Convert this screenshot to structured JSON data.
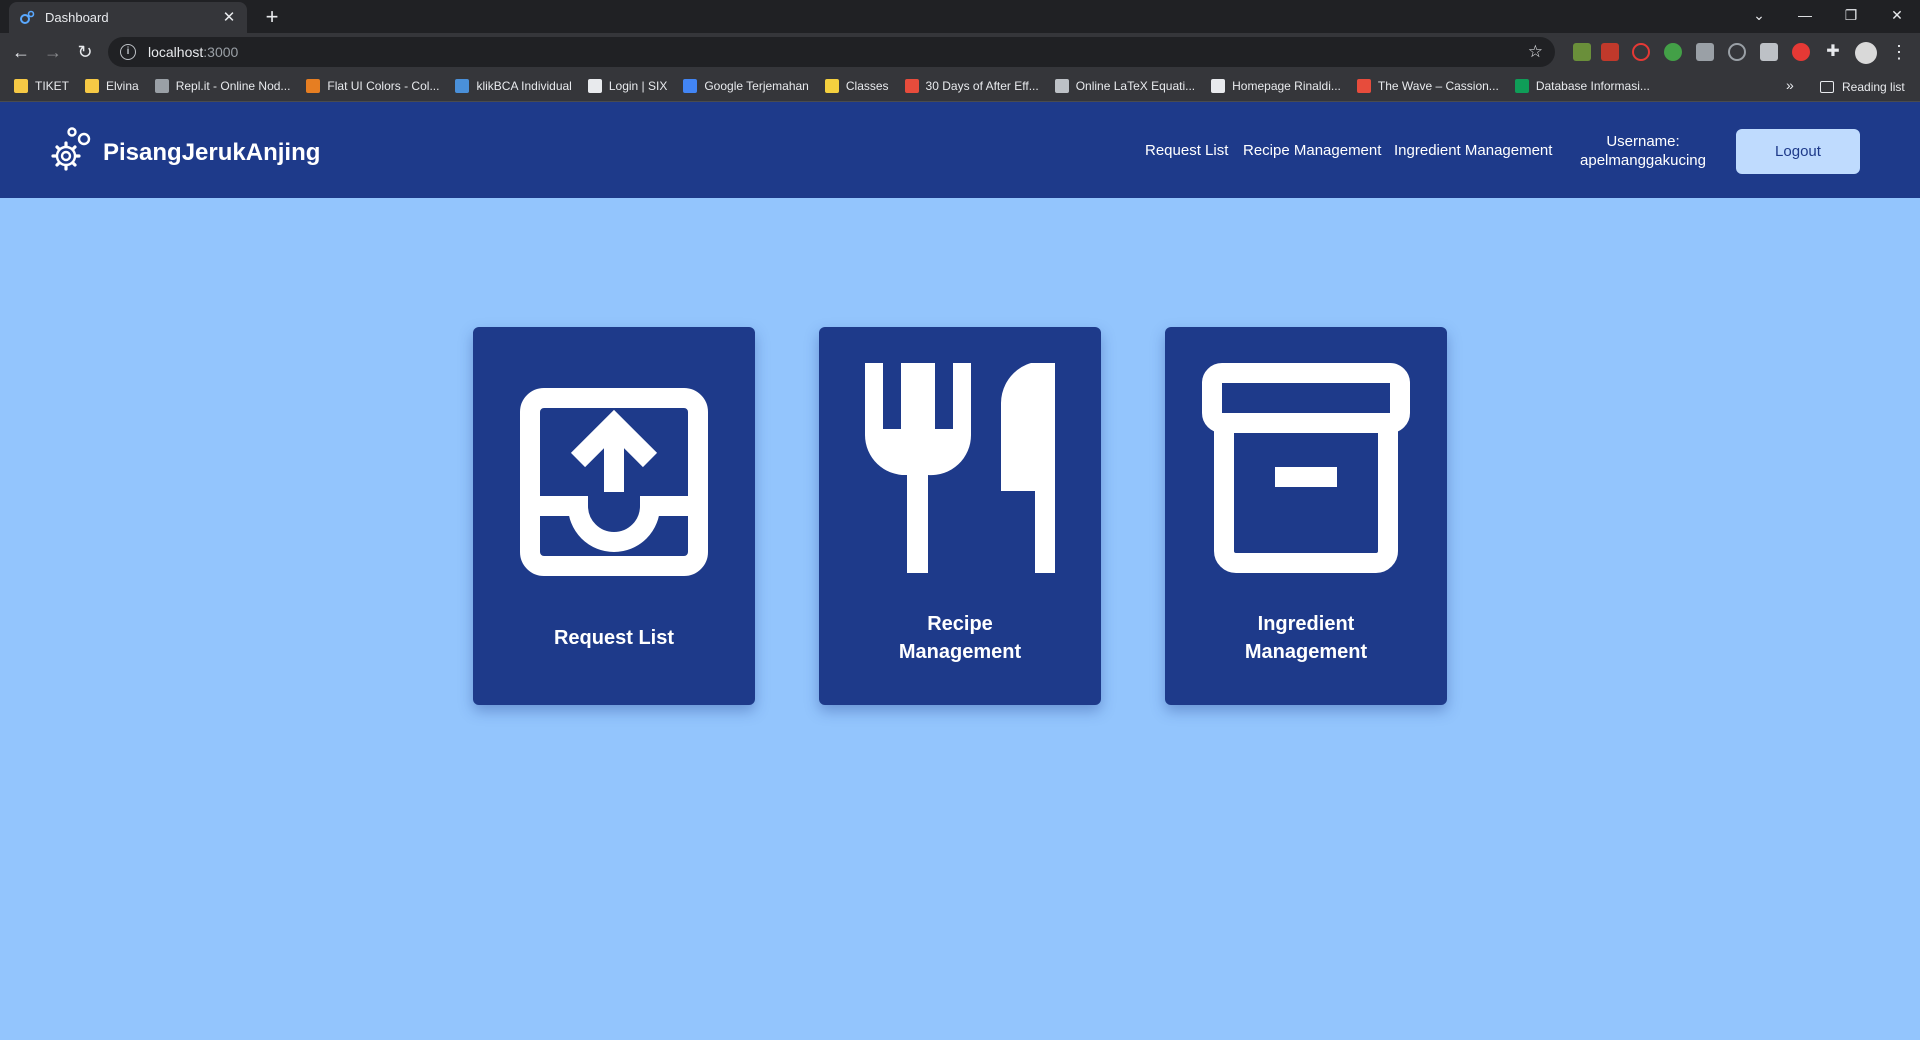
{
  "browser": {
    "tab_title": "Dashboard",
    "url_host": "localhost",
    "url_port": ":3000",
    "bookmarks": [
      {
        "label": "TIKET",
        "color": "#f6c945"
      },
      {
        "label": "Elvina",
        "color": "#f6c945"
      },
      {
        "label": "Repl.it - Online Nod...",
        "color": "#9aa0a6"
      },
      {
        "label": "Flat UI Colors - Col...",
        "color": "#e67e22"
      },
      {
        "label": "klikBCA Individual",
        "color": "#4a90d9"
      },
      {
        "label": "Login | SIX",
        "color": "#e8eaed"
      },
      {
        "label": "Google Terjemahan",
        "color": "#4285f4"
      },
      {
        "label": "Classes",
        "color": "#f4d03f"
      },
      {
        "label": "30 Days of After Eff...",
        "color": "#e74c3c"
      },
      {
        "label": "Online LaTeX Equati...",
        "color": "#bdc1c6"
      },
      {
        "label": "Homepage Rinaldi...",
        "color": "#e8eaed"
      },
      {
        "label": "The Wave – Cassion...",
        "color": "#e74c3c"
      },
      {
        "label": "Database Informasi...",
        "color": "#0f9d58"
      }
    ],
    "reading_list": "Reading list"
  },
  "header": {
    "brand": "PisangJerukAnjing",
    "nav": {
      "request_list": "Request List",
      "recipe_management": "Recipe Management",
      "ingredient_management": "Ingredient Management"
    },
    "username_label": "Username:",
    "username": "apelmanggakucing",
    "logout": "Logout"
  },
  "cards": {
    "request_list": {
      "line1": "Request List",
      "icon": "inbox-upload-icon"
    },
    "recipe": {
      "line1": "Recipe",
      "line2": "Management",
      "icon": "fork-knife-icon"
    },
    "ingredient": {
      "line1": "Ingredient",
      "line2": "Management",
      "icon": "archive-box-icon"
    }
  },
  "colors": {
    "primary": "#1e3a8a",
    "background": "#93c5fd",
    "button": "#bfdbfe"
  }
}
